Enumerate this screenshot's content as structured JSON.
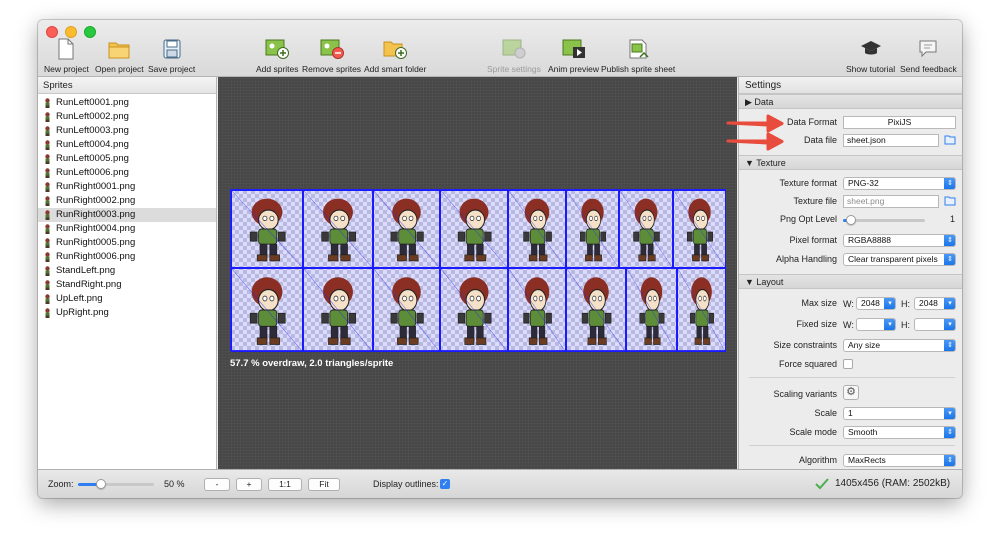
{
  "toolbar": {
    "left": [
      {
        "label": "New project",
        "icon": "document-icon"
      },
      {
        "label": "Open project",
        "icon": "folder-icon"
      },
      {
        "label": "Save project",
        "icon": "floppy-disk-icon"
      }
    ],
    "middle": [
      {
        "label": "Add sprites",
        "icon": "add-image-icon"
      },
      {
        "label": "Remove sprites",
        "icon": "remove-image-icon"
      },
      {
        "label": "Add smart folder",
        "icon": "add-folder-icon"
      }
    ],
    "actions": [
      {
        "label": "Sprite settings",
        "icon": "sprite-settings-icon",
        "disabled": true
      },
      {
        "label": "Anim preview",
        "icon": "film-play-icon"
      },
      {
        "label": "Publish sprite sheet",
        "icon": "publish-icon"
      }
    ],
    "right": [
      {
        "label": "Show tutorial",
        "icon": "graduation-cap-icon"
      },
      {
        "label": "Send feedback",
        "icon": "speech-bubble-icon"
      }
    ]
  },
  "sprites": {
    "header": "Sprites",
    "items": [
      "RunLeft0001.png",
      "RunLeft0002.png",
      "RunLeft0003.png",
      "RunLeft0004.png",
      "RunLeft0005.png",
      "RunLeft0006.png",
      "RunRight0001.png",
      "RunRight0002.png",
      "RunRight0003.png",
      "RunRight0004.png",
      "RunRight0005.png",
      "RunRight0006.png",
      "StandLeft.png",
      "StandRight.png",
      "UpLeft.png",
      "UpRight.png"
    ],
    "selected": "RunRight0003.png"
  },
  "canvas": {
    "overdraw_text": "57.7 % overdraw, 2.0 triangles/sprite"
  },
  "settings": {
    "title": "Settings",
    "data_section": "▶ Data",
    "data_format_label": "Data Format",
    "data_format_value": "PixiJS",
    "data_file_label": "Data file",
    "data_file_value": "sheet.json",
    "texture_section": "▼ Texture",
    "texture_format_label": "Texture format",
    "texture_format_value": "PNG-32",
    "texture_file_label": "Texture file",
    "texture_file_placeholder": "sheet.png",
    "png_opt_label": "Png Opt Level",
    "png_opt_value": "1",
    "png_opt_fraction": 0.1,
    "pixel_format_label": "Pixel format",
    "pixel_format_value": "RGBA8888",
    "alpha_handling_label": "Alpha Handling",
    "alpha_handling_value": "Clear transparent pixels",
    "layout_section": "▼ Layout",
    "max_size_label": "Max size",
    "w_label": "W:",
    "h_label": "H:",
    "max_w": "2048",
    "max_h": "2048",
    "fixed_size_label": "Fixed size",
    "size_constraints_label": "Size constraints",
    "size_constraints_value": "Any size",
    "force_squared_label": "Force squared",
    "scaling_variants_label": "Scaling variants",
    "scale_label": "Scale",
    "scale_value": "1",
    "scale_mode_label": "Scale mode",
    "scale_mode_value": "Smooth",
    "algorithm_label": "Algorithm",
    "algorithm_value": "MaxRects"
  },
  "statusbar": {
    "zoom_label": "Zoom:",
    "zoom_value": "50 %",
    "zoom_fraction": 0.3,
    "minus": "-",
    "plus": "+",
    "one_to_one": "1:1",
    "fit": "Fit",
    "display_outlines": "Display outlines:",
    "display_outlines_checked": true,
    "sheet_info": "1405x456 (RAM: 2502kB)"
  },
  "colors": {
    "accent": "#2f7ff0",
    "annotation_arrow": "#e84c3d",
    "canvas_bg": "#474747",
    "outline": "#1a1aff"
  }
}
